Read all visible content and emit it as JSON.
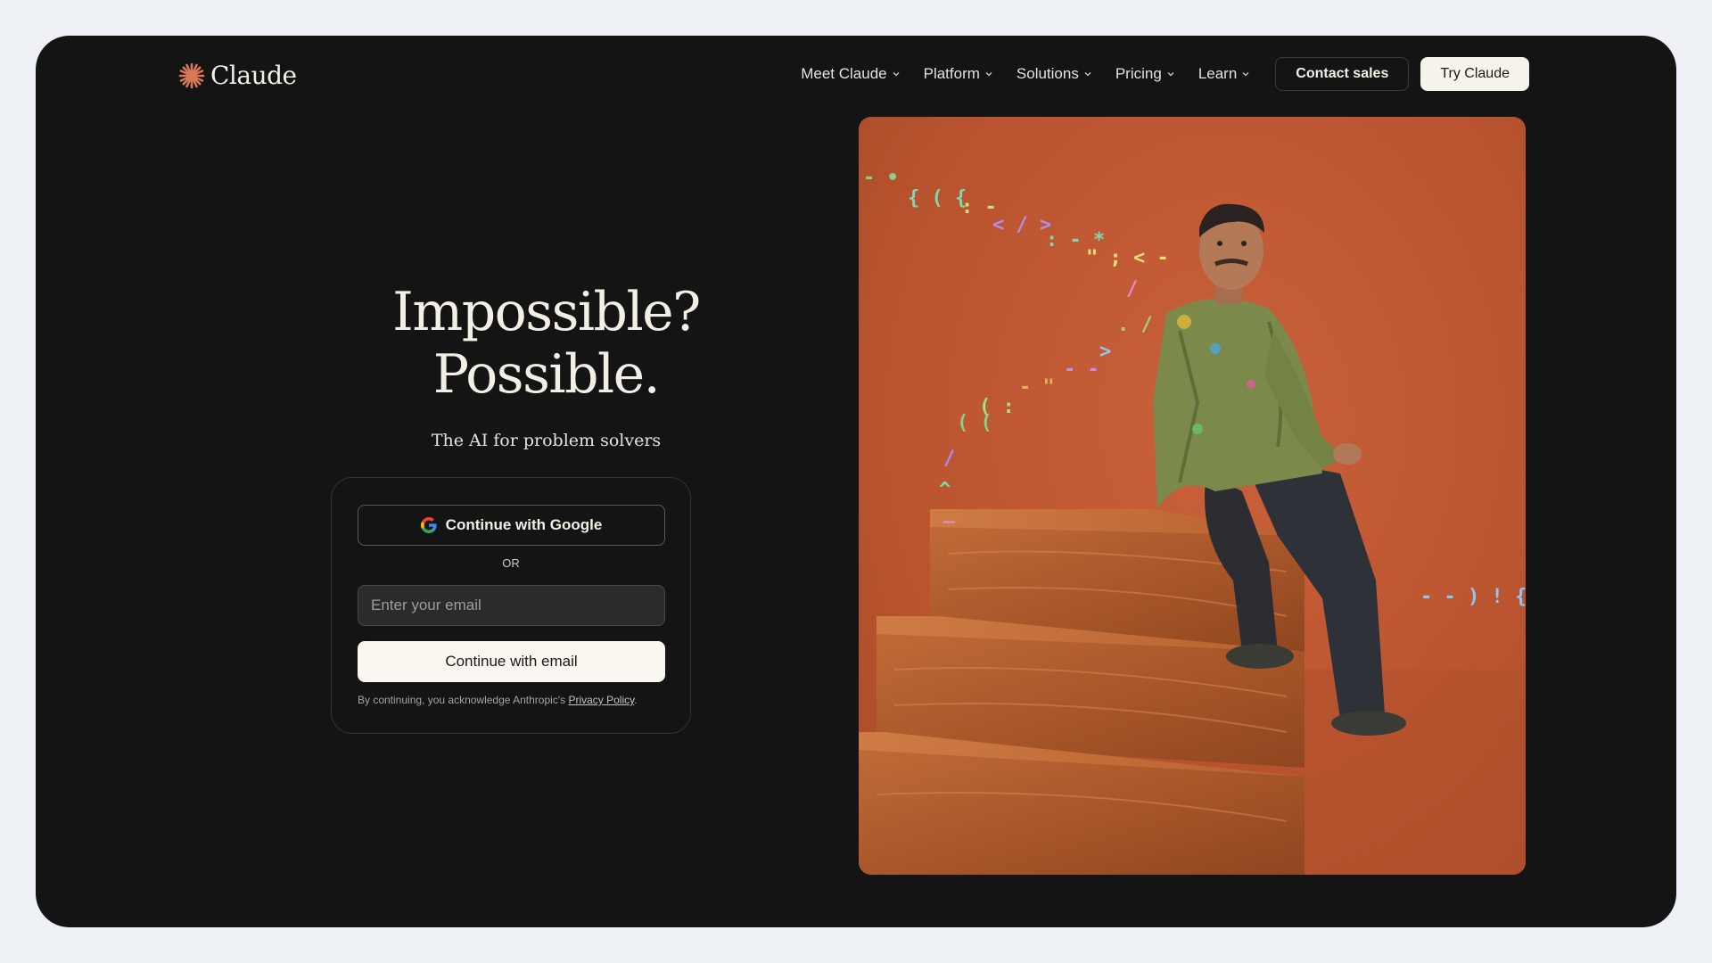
{
  "brand": {
    "name": "Claude",
    "accent": "#d97757"
  },
  "nav": {
    "items": [
      {
        "label": "Meet Claude"
      },
      {
        "label": "Platform"
      },
      {
        "label": "Solutions"
      },
      {
        "label": "Pricing"
      },
      {
        "label": "Learn"
      }
    ],
    "contact_label": "Contact sales",
    "try_label": "Try Claude"
  },
  "hero": {
    "headline_line1": "Impossible?",
    "headline_line2": "Possible.",
    "subhead": "The AI for problem solvers"
  },
  "signin": {
    "google_label": "Continue with Google",
    "or_label": "OR",
    "email_placeholder": "Enter your email",
    "email_value": "",
    "email_button_label": "Continue with email",
    "disclaimer_prefix": "By continuing, you acknowledge Anthropic's ",
    "privacy_link": "Privacy Policy",
    "disclaimer_suffix": "."
  },
  "colors": {
    "page_bg": "#eef2f7",
    "frame_bg": "#141414",
    "photo_bg": "#c45a34",
    "button_light": "#f6f3ec"
  },
  "icons": {
    "logo": "starburst-icon",
    "chevron": "chevron-down-icon",
    "google": "google-g-icon"
  }
}
